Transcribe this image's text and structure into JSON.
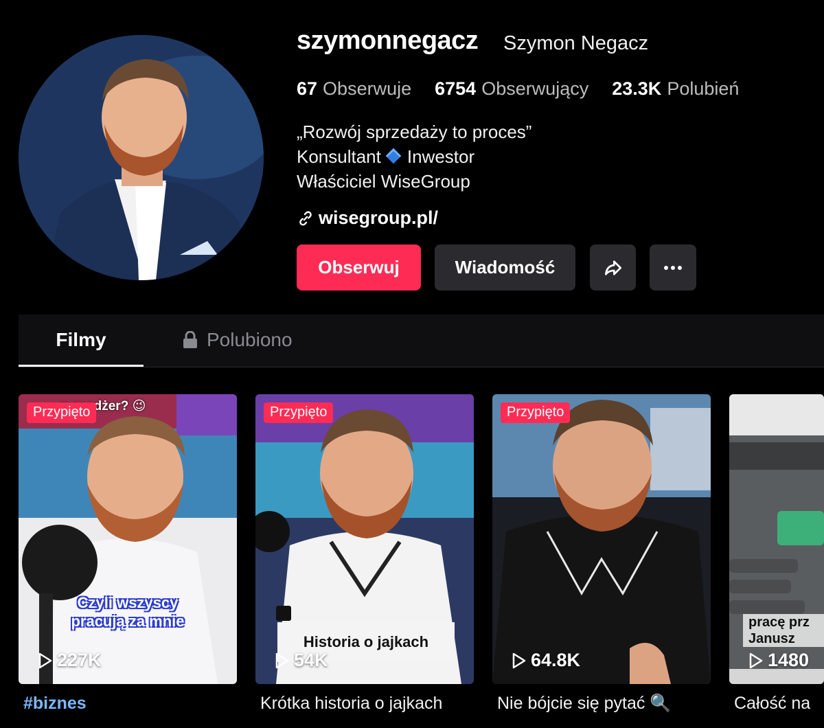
{
  "profile": {
    "username": "szymonnegacz",
    "display_name": "Szymon Negacz",
    "stats": [
      {
        "value": "67",
        "label": "Obserwuje"
      },
      {
        "value": "6754",
        "label": "Obserwujący"
      },
      {
        "value": "23.3K",
        "label": "Polubień"
      }
    ],
    "bio_line1": "„Rozwój sprzedaży to proces”",
    "bio_line2a": "Konsultant",
    "bio_line2b": "Inwestor",
    "bio_line3": "Właściciel WiseGroup",
    "link": "wisegroup.pl/"
  },
  "actions": {
    "follow": "Obserwuj",
    "message": "Wiadomość",
    "share_icon": "share-icon",
    "more_icon": "more-icon"
  },
  "tabs": [
    {
      "label": "Filmy",
      "active": true
    },
    {
      "label": "Polubiono",
      "locked": true
    }
  ],
  "videos": [
    {
      "pinned": "Przypięto",
      "views": "227K",
      "overlay_top": "menedżer? 😉",
      "overlay_line1": "Czyli wszyscy",
      "overlay_line2": "pracują za mnie",
      "caption": "#biznes"
    },
    {
      "pinned": "Przypięto",
      "views": "54K",
      "overlay": "Historia o jajkach",
      "caption": "Krótka historia o jajkach"
    },
    {
      "pinned": "Przypięto",
      "views": "64.8K",
      "caption": "Nie bójcie się pytać 🔍"
    },
    {
      "views": "1480",
      "overlay_line1": "pracę prz",
      "overlay_line2": "Janusz",
      "caption": "Całość na"
    }
  ],
  "colors": {
    "accent": "#fe2c55",
    "background": "#000000",
    "button": "#2b2b2f",
    "hashtag": "#7ab8ff"
  }
}
